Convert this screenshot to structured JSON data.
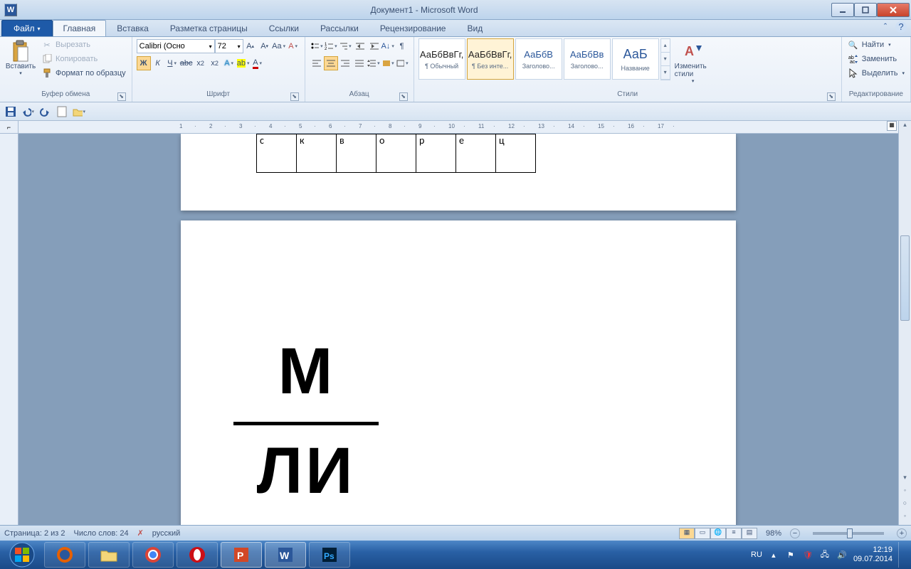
{
  "window": {
    "title": "Документ1 - Microsoft Word",
    "app_letter": "W"
  },
  "tabs": {
    "file": "Файл",
    "items": [
      "Главная",
      "Вставка",
      "Разметка страницы",
      "Ссылки",
      "Рассылки",
      "Рецензирование",
      "Вид"
    ],
    "active_index": 0
  },
  "ribbon": {
    "clipboard": {
      "label": "Буфер обмена",
      "paste": "Вставить",
      "cut": "Вырезать",
      "copy": "Копировать",
      "format_painter": "Формат по образцу"
    },
    "font": {
      "label": "Шрифт",
      "name": "Calibri (Осно",
      "size": "72"
    },
    "paragraph": {
      "label": "Абзац"
    },
    "styles": {
      "label": "Стили",
      "change": "Изменить стили",
      "items": [
        {
          "preview": "АаБбВвГг,",
          "name": "¶ Обычный",
          "cls": ""
        },
        {
          "preview": "АаБбВвГг,",
          "name": "¶ Без инте...",
          "cls": ""
        },
        {
          "preview": "АаБбВ",
          "name": "Заголово...",
          "cls": "blue"
        },
        {
          "preview": "АаБбВв",
          "name": "Заголово...",
          "cls": "blue"
        },
        {
          "preview": "АаБ",
          "name": "Название",
          "cls": "blue big"
        }
      ],
      "selected_index": 1
    },
    "editing": {
      "label": "Редактирование",
      "find": "Найти",
      "replace": "Заменить",
      "select": "Выделить"
    }
  },
  "ruler_numbers": [
    1,
    2,
    3,
    4,
    5,
    6,
    7,
    8,
    9,
    10,
    11,
    12,
    13,
    14,
    15,
    16,
    17
  ],
  "document": {
    "table_letters": [
      "с",
      "к",
      "в",
      "о",
      "р",
      "е",
      "ц"
    ],
    "big_top": "М",
    "big_bottom": "ЛИ"
  },
  "statusbar": {
    "page": "Страница: 2 из 2",
    "words": "Число слов: 24",
    "language": "русский",
    "zoom": "98%"
  },
  "taskbar": {
    "lang": "RU",
    "time": "12:19",
    "date": "09.07.2014"
  }
}
